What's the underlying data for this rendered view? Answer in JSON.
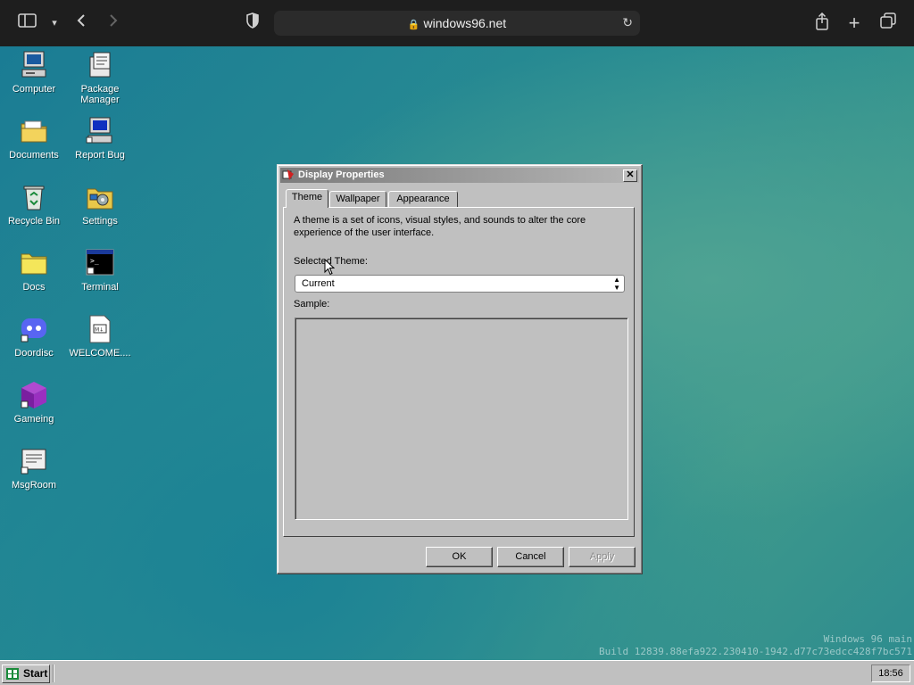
{
  "browser": {
    "url": "windows96.net"
  },
  "desktop": {
    "icons": [
      {
        "label": "Computer",
        "icon": "computer-icon"
      },
      {
        "label": "Package Manager",
        "icon": "package-manager-icon"
      },
      {
        "label": "Documents",
        "icon": "folder-icon"
      },
      {
        "label": "Report Bug",
        "icon": "report-bug-icon"
      },
      {
        "label": "Recycle Bin",
        "icon": "recycle-bin-icon"
      },
      {
        "label": "Settings",
        "icon": "settings-icon"
      },
      {
        "label": "Docs",
        "icon": "folder-icon"
      },
      {
        "label": "Terminal",
        "icon": "terminal-icon"
      },
      {
        "label": "Doordisc",
        "icon": "doordisc-icon"
      },
      {
        "label": "WELCOME....",
        "icon": "markdown-file-icon"
      },
      {
        "label": "Gameing",
        "icon": "cube-icon"
      },
      {
        "label": "MsgRoom",
        "icon": "msgroom-icon"
      }
    ],
    "watermark_line1": "Windows 96 main",
    "watermark_line2": "Build 12839.88efa922.230410-1942.d77c73edcc428f7bc571"
  },
  "dialog": {
    "title": "Display Properties",
    "close_label": "✕",
    "tabs": [
      {
        "label": "Theme",
        "active": true
      },
      {
        "label": "Wallpaper",
        "active": false
      },
      {
        "label": "Appearance",
        "active": false
      }
    ],
    "description": "A theme is a set of icons, visual styles, and sounds to alter the core experience of the user interface.",
    "selected_theme_label": "Selected Theme:",
    "selected_theme_value": "Current",
    "sample_label": "Sample:",
    "buttons": {
      "ok": "OK",
      "cancel": "Cancel",
      "apply": "Apply"
    }
  },
  "taskbar": {
    "start_label": "Start",
    "clock": "18:56"
  }
}
